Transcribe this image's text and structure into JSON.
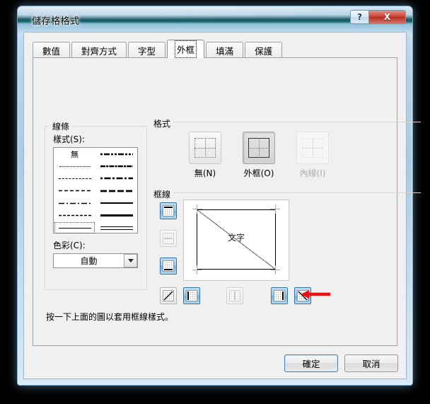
{
  "window": {
    "title": "儲存格格式",
    "help_button": "?",
    "close_button": "X"
  },
  "tabs": [
    {
      "label": "數值",
      "active": false
    },
    {
      "label": "對齊方式",
      "active": false
    },
    {
      "label": "字型",
      "active": false
    },
    {
      "label": "外框",
      "active": true
    },
    {
      "label": "填滿",
      "active": false
    },
    {
      "label": "保護",
      "active": false
    }
  ],
  "lines_group": {
    "title": "線條",
    "style_label": "樣式(S):",
    "none_label": "無",
    "color_label": "色彩(C):",
    "color_value": "自動",
    "styles_left": [
      "none",
      "dotted-fine",
      "dotted",
      "dashed",
      "dash-dot",
      "dashed-medium",
      "solid-thin"
    ],
    "styles_right": [
      "dash-dot-dot-bold",
      "dash-dot-slant",
      "dash-dot-bold",
      "dashed-bold",
      "solid-medium",
      "solid-bold",
      "double"
    ],
    "selected_style": "solid-thin"
  },
  "presets": {
    "title": "格式",
    "items": [
      {
        "label": "無(N)",
        "key": "N",
        "state": "normal",
        "name": "none"
      },
      {
        "label": "外框(O)",
        "key": "O",
        "state": "pressed",
        "name": "outline"
      },
      {
        "label": "內線(I)",
        "key": "I",
        "state": "disabled",
        "name": "inside"
      }
    ]
  },
  "border": {
    "title": "框線",
    "preview_text": "文字",
    "hint": "按一下上面的圖以套用框線樣式。",
    "buttons": [
      {
        "name": "border-top",
        "state": "on"
      },
      {
        "name": "border-horizontal-inside",
        "state": "off"
      },
      {
        "name": "border-bottom",
        "state": "on"
      },
      {
        "name": "border-diagonal-down",
        "state": "normal"
      },
      {
        "name": "border-diagonal-up",
        "state": "normal"
      },
      {
        "name": "border-left",
        "state": "on"
      },
      {
        "name": "border-vertical-inside",
        "state": "off"
      },
      {
        "name": "border-right",
        "state": "on"
      },
      {
        "name": "border-diagonal-down-2",
        "state": "on"
      }
    ]
  },
  "annotation": {
    "arrow_color": "#ee1111",
    "points_at": "border-diagonal-down-2"
  },
  "footer": {
    "ok_label": "確定",
    "cancel_label": "取消"
  },
  "colors": {
    "accent": "#2c6ca8",
    "titlebar_dark": "#15585f",
    "close_red": "#c9473a",
    "dialog_bg": "#f0f0f0"
  }
}
